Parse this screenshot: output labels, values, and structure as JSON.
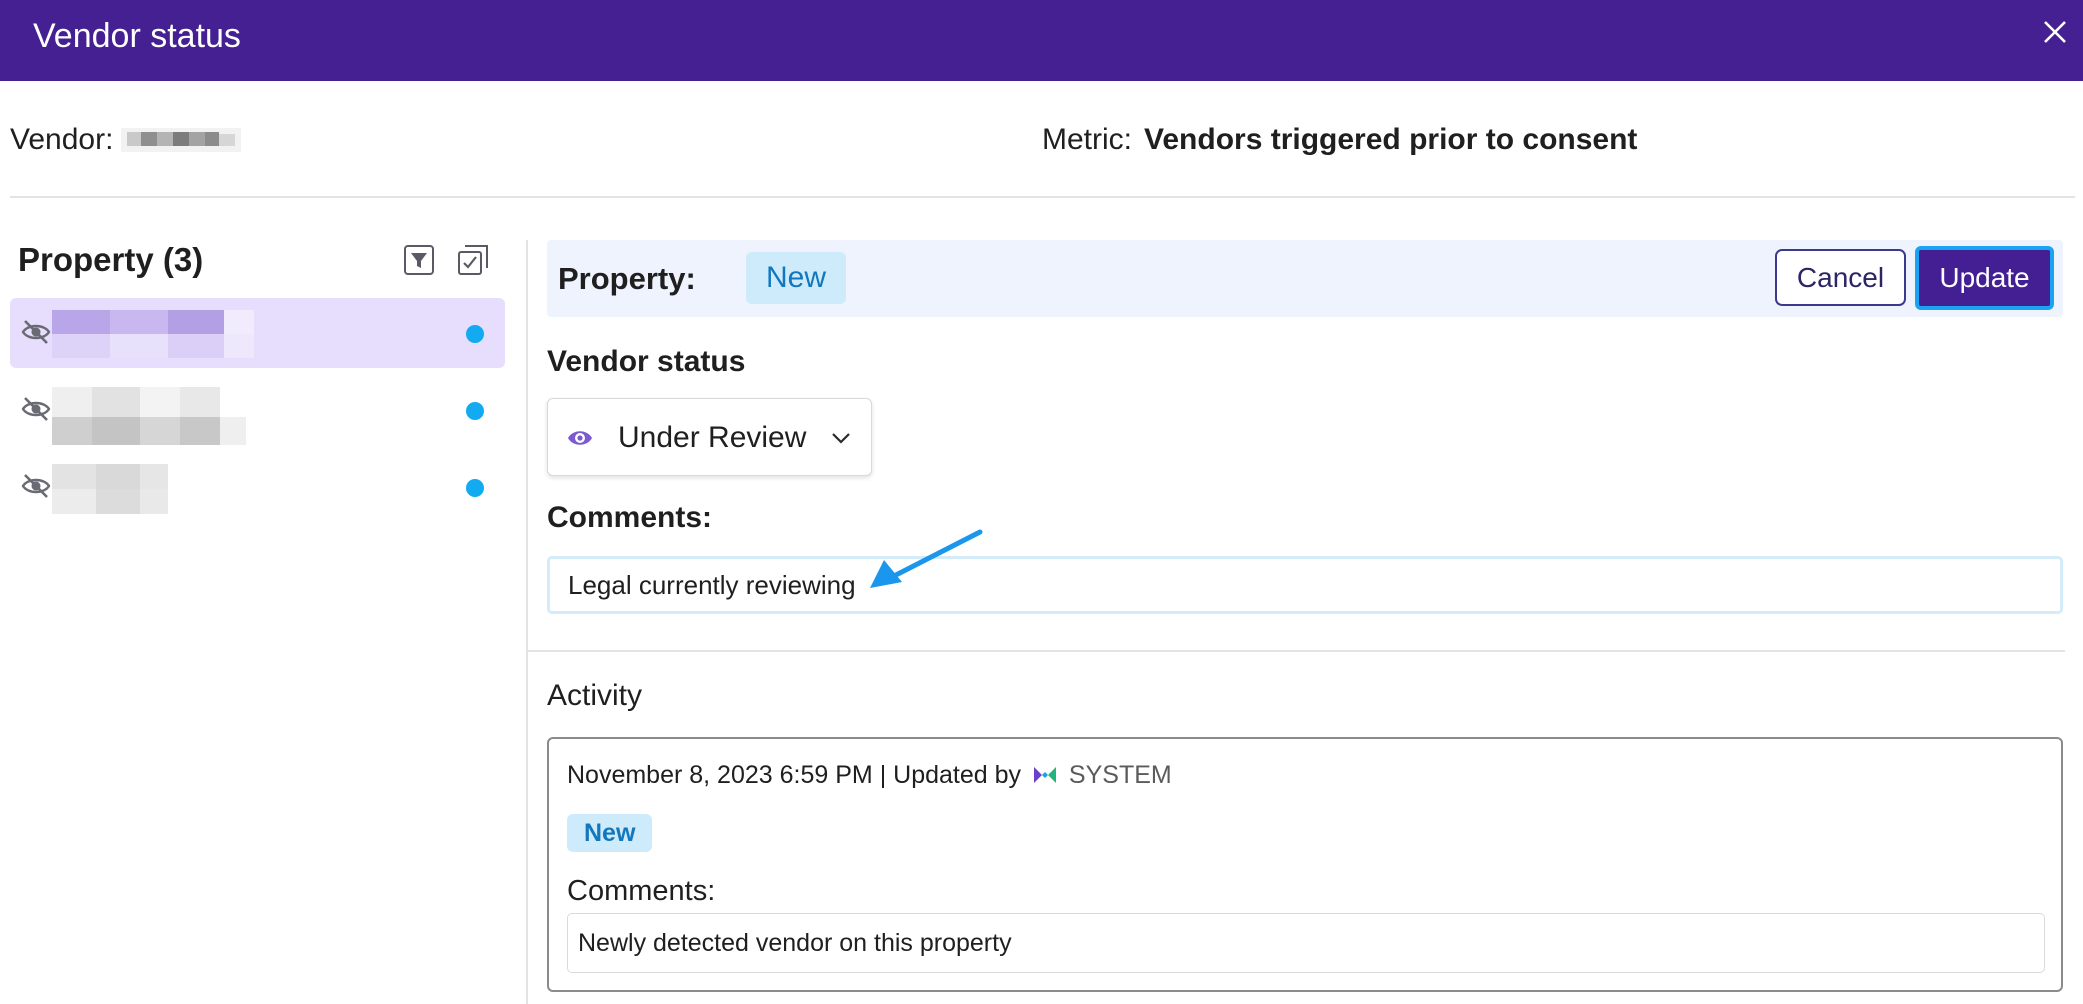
{
  "dialog": {
    "title": "Vendor status"
  },
  "vendor": {
    "label": "Vendor:"
  },
  "metric": {
    "label": "Metric:",
    "value": "Vendors triggered prior to consent"
  },
  "property_list": {
    "title": "Property (3)",
    "items": [
      {
        "selected": true,
        "status_color": "#12aaf0"
      },
      {
        "selected": false,
        "status_color": "#12aaf0"
      },
      {
        "selected": false,
        "status_color": "#12aaf0"
      }
    ]
  },
  "editor": {
    "property_label": "Property:",
    "property_badge": "New",
    "cancel_label": "Cancel",
    "update_label": "Update",
    "vendor_status_label": "Vendor status",
    "vendor_status_value": "Under Review",
    "comments_label": "Comments:",
    "comments_value": "Legal currently reviewing"
  },
  "activity": {
    "title": "Activity",
    "entries": [
      {
        "timestamp": "November 8, 2023 6:59 PM",
        "separator": "|",
        "updated_by_label": "Updated by",
        "user": "SYSTEM",
        "badge": "New",
        "comments_label": "Comments:",
        "comment": "Newly detected vendor on this property"
      }
    ]
  },
  "colors": {
    "header": "#452092",
    "primary_button": "#441f93",
    "accent_blue": "#12aaf0",
    "badge_bg": "#cdebfb",
    "badge_text": "#1277bd",
    "selected_row": "#e6defc"
  }
}
